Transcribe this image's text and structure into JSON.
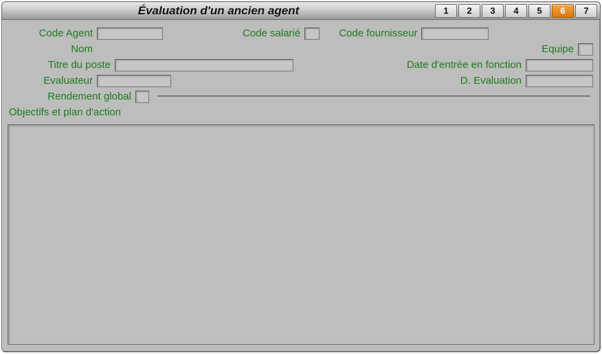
{
  "window": {
    "title": "Évaluation d'un ancien agent"
  },
  "tabs": {
    "items": [
      "1",
      "2",
      "3",
      "4",
      "5",
      "6",
      "7"
    ],
    "active_index": 5
  },
  "labels": {
    "code_agent": "Code Agent",
    "code_salarie": "Code salarié",
    "code_fournisseur": "Code fournisseur",
    "nom": "Nom",
    "equipe": "Equipe",
    "titre_poste": "Titre du poste",
    "date_entree": "Date d'entrée en fonction",
    "evaluateur": "Evaluateur",
    "d_evaluation": "D. Evaluation",
    "rendement_global": "Rendement global",
    "objectifs": "Objectifs et plan d'action"
  },
  "values": {
    "code_agent": "",
    "code_salarie": "",
    "code_fournisseur": "",
    "nom": "",
    "equipe": "",
    "titre_poste": "",
    "date_entree": "",
    "evaluateur": "",
    "d_evaluation": "",
    "rendement_global": "",
    "objectifs": ""
  }
}
